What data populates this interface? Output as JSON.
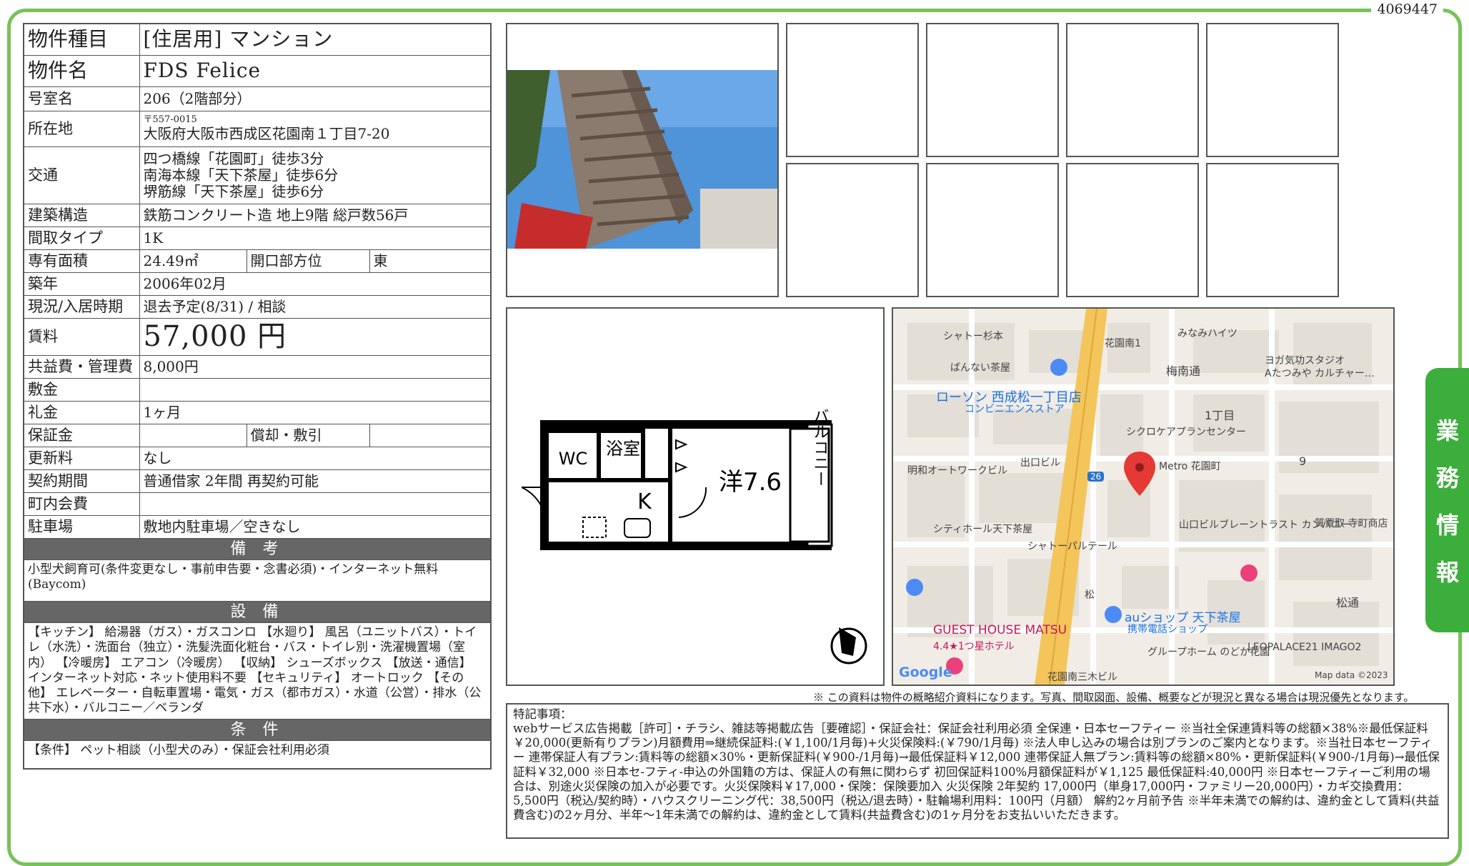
{
  "document_id": "4069447",
  "property": {
    "rows": [
      {
        "label": "物件種目",
        "value": "[住居用] マンション"
      },
      {
        "label": "物件名",
        "value": "FDS Felice"
      },
      {
        "label": "号室名",
        "value": "206（2階部分）"
      },
      {
        "label": "所在地",
        "postal": "〒557-0015",
        "value": "大阪府大阪市西成区花園南１丁目7-20"
      },
      {
        "label": "交通",
        "lines": [
          "四つ橋線「花園町」徒歩3分",
          "南海本線「天下茶屋」徒歩6分",
          "堺筋線「天下茶屋」徒歩6分"
        ]
      },
      {
        "label": "建築構造",
        "value": "鉄筋コンクリート造 地上9階 総戸数56戸"
      },
      {
        "label": "間取タイプ",
        "value": "1K"
      },
      {
        "label": "専有面積",
        "value": "24.49㎡",
        "label2": "開口部方位",
        "value2": "東"
      },
      {
        "label": "築年",
        "value": "2006年02月"
      },
      {
        "label": "現況/入居時期",
        "value": "退去予定(8/31) / 相談"
      },
      {
        "label": "賃料",
        "value": "57,000 円"
      },
      {
        "label": "共益費・管理費",
        "value": "8,000円"
      },
      {
        "label": "敷金",
        "value": ""
      },
      {
        "label": "礼金",
        "value": "1ヶ月"
      },
      {
        "label": "保証金",
        "value": "",
        "label2": "償却・敷引",
        "value2": ""
      },
      {
        "label": "更新料",
        "value": "なし"
      },
      {
        "label": "契約期間",
        "value": "普通借家 2年間 再契約可能"
      },
      {
        "label": "町内会費",
        "value": ""
      },
      {
        "label": "駐車場",
        "value": "敷地内駐車場／空きなし"
      }
    ],
    "remarks_header": "備 考",
    "remarks": "小型犬飼育可(条件変更なし・事前申告要・念書必須)・インターネット無料(Baycom)",
    "equipment_header": "設 備",
    "equipment": "【キッチン】 給湯器（ガス）・ガスコンロ 【水廻り】 風呂（ユニットバス）・トイレ（水洗）・洗面台（独立）・洗髪洗面化粧台・バス・トイレ別・洗濯機置場（室内） 【冷暖房】 エアコン（冷暖房） 【収納】 シューズボックス 【放送・通信】 インターネット対応・ネット使用料不要 【セキュリティ】 オートロック 【その他】 エレベーター・自転車置場・電気・ガス（都市ガス）・水道（公営）・排水（公共下水）・バルコニー／ベランダ",
    "conditions_header": "条 件",
    "conditions": "【条件】 ペット相談（小型犬のみ）・保証会社利用必須"
  },
  "floorplan": {
    "wc": "WC",
    "bath": "浴室",
    "kitchen": "K",
    "room": "洋7.6",
    "balcony": "バルコニー"
  },
  "map": {
    "labels": [
      "シャトー杉本",
      "花園南1",
      "みなみハイツ",
      "ばんない茶屋",
      "梅南通",
      "ヨガ気功スタジオ",
      "Aたつみや カルチャー…",
      "ローソン 西成松一丁目店",
      "コンビニエンスストア",
      "1丁目",
      "シクロケアプランセンター",
      "明和オートワークビル",
      "出口ビル",
      "Metro 花園町",
      "9",
      "シティホール天下茶屋",
      "シャトーパルテール",
      "山口ビル",
      "ブレーントラスト カンパニー",
      "質買取 寺町商店",
      "松",
      "松通",
      "auショップ 天下茶屋",
      "携帯電話ショップ",
      "GUEST HOUSE MATSU",
      "4.4★1つ星ホテル",
      "グループホーム のどか花園",
      "LEOPALACE21 IMAGO2",
      "花園南三木ビル",
      "Google",
      "Map data ©2023",
      "26"
    ]
  },
  "disclaimer": "※ この資料は物件の概略紹介資料になります。写真、間取図面、設備、概要などが現況と異なる場合は現況優先となります。",
  "special_notes_title": "特記事項：",
  "special_notes": "webサービス広告掲載［許可］・チラシ、雑誌等掲載広告［要確認］・保証会社：保証会社利用必須 全保連・日本セーフティー ※当社全保連賃料等の総額×38%※最低保証料￥20,000(更新有りプラン)月額費用⇒継続保証料:(￥1,100/1月毎)+火災保険料:(￥790/1月毎) ※法人申し込みの場合は別プランのご案内となります。※当社日本セーフティー 連帯保証人有プラン:賃料等の総額×30%・更新保証料(￥900-/1月毎)→最低保証料￥12,000 連帯保証人無プラン:賃料等の総額×80%・更新保証料(￥900-/1月毎)→最低保証料￥32,000 ※日本セ-フティ-申込の外国籍の方は、保証人の有無に関わらず 初回保証料100%月額保証料が￥1,125 最低保証料:40,000円 ※日本セーフティーご利用の場合は、別途火災保険の加入が必要です。火災保険料￥17,000・保険：保険要加入 火災保険 2年契約 17,000円（単身17,000円・ファミリー20,000円）・カギ交換費用：5,500円（税込/契約時）・ハウスクリーニング代：38,500円（税込/退去時）・駐輪場利用料：100円（月額） 解約2ヶ月前予告 ※半年未満での解約は、違約金として賃料(共益費含む)の2ヶ月分、半年～1年未満での解約は、違約金として賃料(共益費含む)の1ヶ月分をお支払いいただきます。",
  "side_tab": [
    "業",
    "務",
    "情",
    "報"
  ]
}
